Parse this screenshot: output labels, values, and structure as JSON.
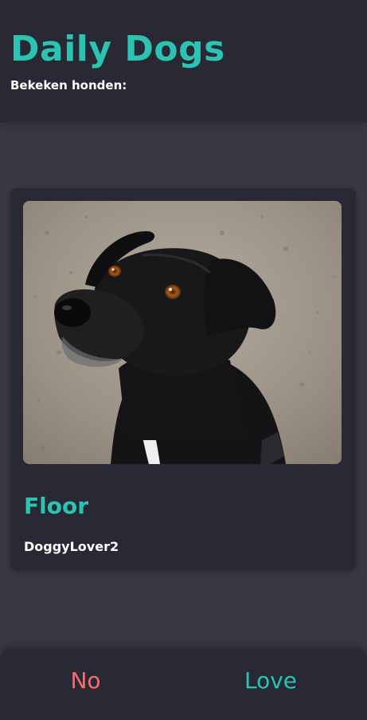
{
  "header": {
    "title": "Daily Dogs",
    "viewed_label": "Bekeken honden:",
    "viewed_count": ""
  },
  "card": {
    "dog_name": "Floor",
    "owner": "DoggyLover2",
    "photo_alt": "black dog"
  },
  "actions": {
    "no_label": "No",
    "love_label": "Love"
  },
  "colors": {
    "accent": "#2cc3b2",
    "reject": "#f76d6d",
    "surface": "#292935",
    "background": "#393945"
  }
}
